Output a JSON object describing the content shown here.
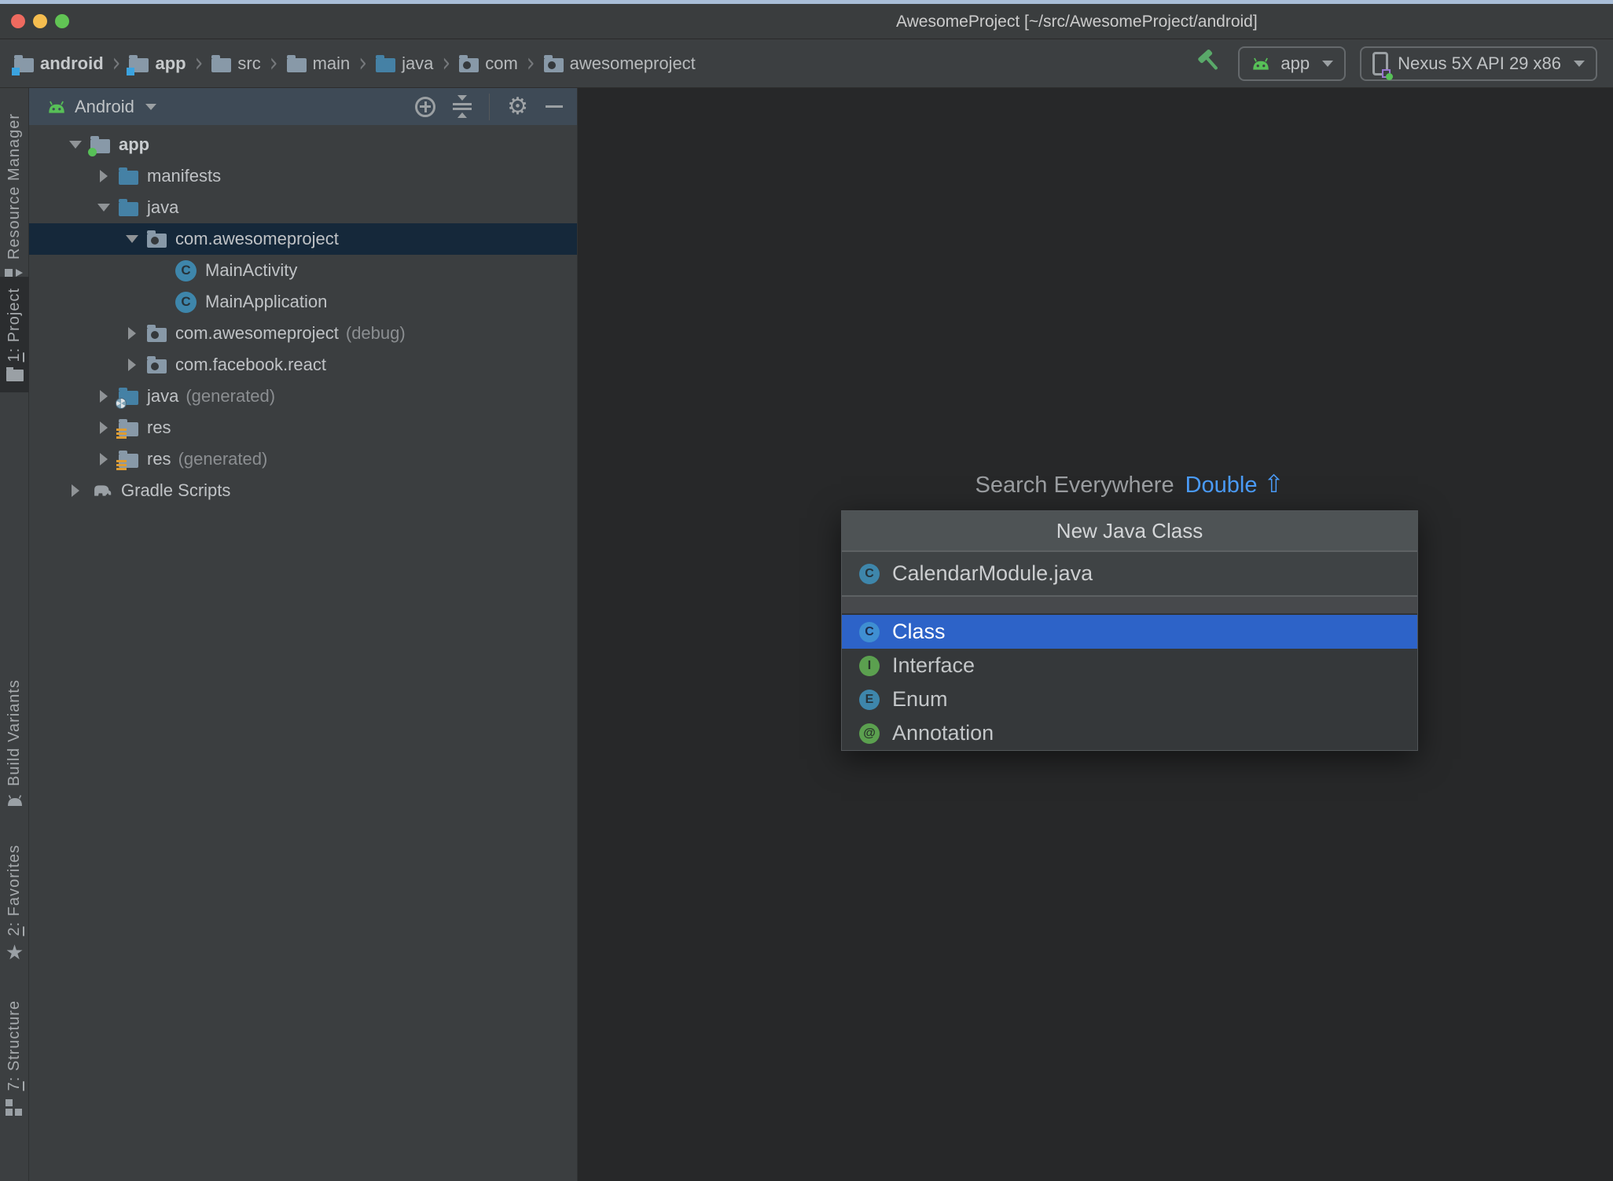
{
  "titlebar": {
    "title": "AwesomeProject [~/src/AwesomeProject/android]"
  },
  "navbar": {
    "items": [
      {
        "label": "android"
      },
      {
        "label": "app"
      },
      {
        "label": "src"
      },
      {
        "label": "main"
      },
      {
        "label": "java"
      },
      {
        "label": "com"
      },
      {
        "label": "awesomeproject"
      }
    ],
    "separator": "›"
  },
  "toolbar": {
    "run_config": "app",
    "device": "Nexus 5X API 29 x86"
  },
  "left_bar": {
    "resource_manager": {
      "label": "Resource Manager"
    },
    "project": {
      "mnemonic": "1",
      "rest": ": Project"
    },
    "build_variants": {
      "label": "Build Variants"
    },
    "favorites": {
      "mnemonic": "2",
      "rest": ": Favorites"
    },
    "structure": {
      "mnemonic": "7",
      "rest": ": Structure"
    }
  },
  "project_panel": {
    "view": "Android",
    "tree": [
      {
        "label": "app"
      },
      {
        "label": "manifests"
      },
      {
        "label": "java"
      },
      {
        "label": "com.awesomeproject"
      },
      {
        "label": "MainActivity",
        "icon_letter": "C"
      },
      {
        "label": "MainApplication",
        "icon_letter": "C"
      },
      {
        "label": "com.awesomeproject",
        "suffix": "(debug)"
      },
      {
        "label": "com.facebook.react"
      },
      {
        "label": "java",
        "suffix": "(generated)"
      },
      {
        "label": "res"
      },
      {
        "label": "res",
        "suffix": "(generated)"
      },
      {
        "label": "Gradle Scripts"
      }
    ]
  },
  "editor": {
    "hint": {
      "text": "Search Everywhere",
      "shortcut": "Double",
      "symbol": "⇧"
    }
  },
  "popup": {
    "title": "New Java Class",
    "filename": "CalendarModule.java",
    "filename_icon_letter": "C",
    "options": [
      {
        "label": "Class",
        "icon_letter": "C",
        "selected": true
      },
      {
        "label": "Interface",
        "icon_letter": "I"
      },
      {
        "label": "Enum",
        "icon_letter": "E"
      },
      {
        "label": "Annotation",
        "icon_letter": "@"
      }
    ]
  },
  "colors": {
    "selection_blue": "#2d63c8",
    "tree_selection": "#15283a",
    "android_green": "#57c057",
    "accent_blue": "#4b9cf9",
    "teal_folder": "#4581a5",
    "panel_header": "#3e4a56"
  }
}
